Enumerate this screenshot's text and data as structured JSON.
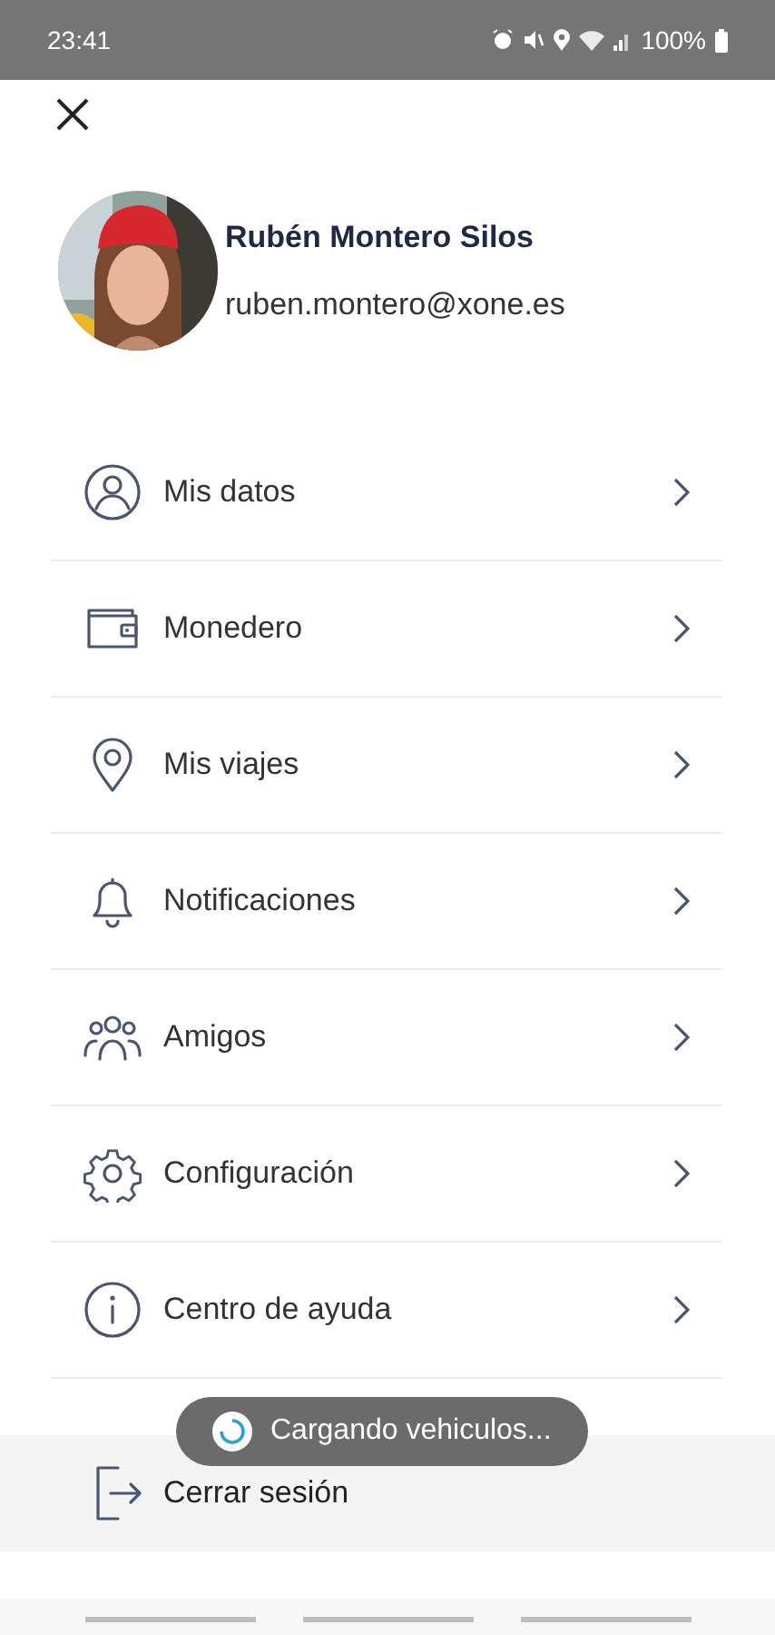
{
  "status_bar": {
    "time": "23:41",
    "battery": "100%"
  },
  "profile": {
    "name": "Rubén Montero Silos",
    "email": "ruben.montero@xone.es"
  },
  "menu": [
    {
      "label": "Mis datos"
    },
    {
      "label": "Monedero"
    },
    {
      "label": "Mis viajes"
    },
    {
      "label": "Notificaciones"
    },
    {
      "label": "Amigos"
    },
    {
      "label": "Configuración"
    },
    {
      "label": "Centro de ayuda"
    }
  ],
  "logout": {
    "label": "Cerrar sesión"
  },
  "toast": {
    "text": "Cargando vehiculos..."
  }
}
